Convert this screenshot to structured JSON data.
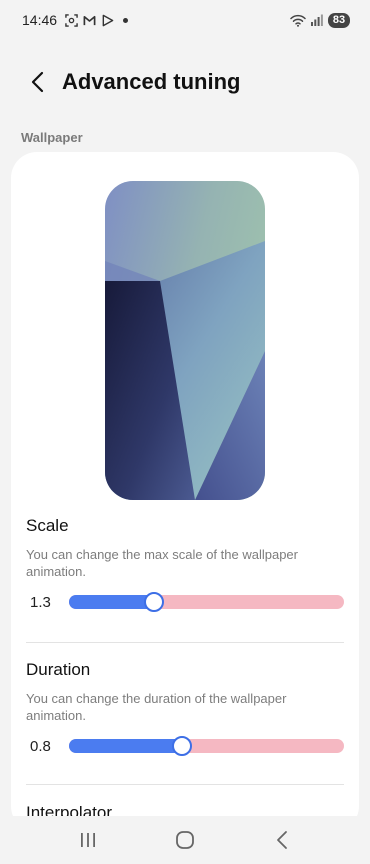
{
  "status_bar": {
    "time": "14:46",
    "battery": "83",
    "icons": [
      "screenshot-icon",
      "gmail-icon",
      "play-icon",
      "notification-dot",
      "wifi-icon",
      "signal-icon",
      "battery-icon"
    ]
  },
  "header": {
    "title": "Advanced tuning",
    "back_icon": "back-arrow-icon"
  },
  "section": {
    "label": "Wallpaper"
  },
  "settings": [
    {
      "title": "Scale",
      "description": "You can change the max scale of the wallpaper animation.",
      "value": "1.3",
      "fraction": 0.31
    },
    {
      "title": "Duration",
      "description": "You can change the duration of the wallpaper animation.",
      "value": "0.8",
      "fraction": 0.41
    },
    {
      "title": "Interpolator"
    }
  ],
  "colors": {
    "slider_active": "#4b7cf0",
    "slider_inactive": "#f5b8c2",
    "background": "#f3f3f3",
    "card": "#ffffff"
  },
  "nav_bar": {
    "icons": [
      "recents-icon",
      "home-icon",
      "back-icon"
    ]
  }
}
